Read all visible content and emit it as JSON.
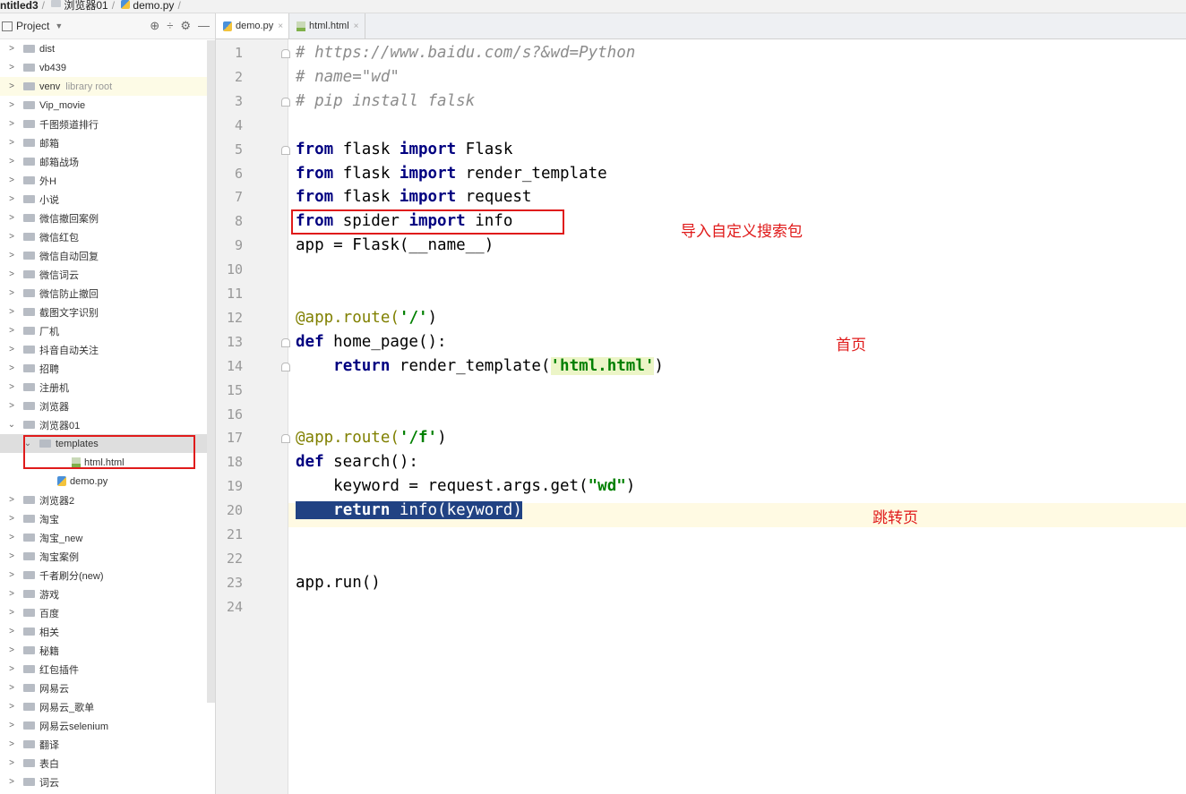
{
  "breadcrumb": [
    "ntitled3",
    "浏览器01",
    "demo.py"
  ],
  "sidebar": {
    "title": "Project",
    "tree": [
      {
        "label": "dist",
        "type": "folder",
        "expanded": false,
        "indent": 0
      },
      {
        "label": "vb439",
        "type": "folder",
        "expanded": false,
        "indent": 0
      },
      {
        "label": "venv",
        "suffix": "library root",
        "type": "folder",
        "expanded": false,
        "indent": 0,
        "highlight": true
      },
      {
        "label": "Vip_movie",
        "type": "folder",
        "expanded": false,
        "indent": 0
      },
      {
        "label": "千图频道排行",
        "type": "folder",
        "expanded": false,
        "indent": 0
      },
      {
        "label": "邮箱",
        "type": "folder",
        "expanded": false,
        "indent": 0
      },
      {
        "label": "邮箱战场",
        "type": "folder",
        "expanded": false,
        "indent": 0
      },
      {
        "label": "外H",
        "type": "folder",
        "expanded": false,
        "indent": 0
      },
      {
        "label": "小说",
        "type": "folder",
        "expanded": false,
        "indent": 0
      },
      {
        "label": "微信撤回案例",
        "type": "folder",
        "expanded": false,
        "indent": 0
      },
      {
        "label": "微信红包",
        "type": "folder",
        "expanded": false,
        "indent": 0
      },
      {
        "label": "微信自动回复",
        "type": "folder",
        "expanded": false,
        "indent": 0
      },
      {
        "label": "微信词云",
        "type": "folder",
        "expanded": false,
        "indent": 0
      },
      {
        "label": "微信防止撤回",
        "type": "folder",
        "expanded": false,
        "indent": 0
      },
      {
        "label": "截图文字识别",
        "type": "folder",
        "expanded": false,
        "indent": 0
      },
      {
        "label": "厂机",
        "type": "folder",
        "expanded": false,
        "indent": 0
      },
      {
        "label": "抖音自动关注",
        "type": "folder",
        "expanded": false,
        "indent": 0
      },
      {
        "label": "招聘",
        "type": "folder",
        "expanded": false,
        "indent": 0
      },
      {
        "label": "注册机",
        "type": "folder",
        "expanded": false,
        "indent": 0
      },
      {
        "label": "浏览器",
        "type": "folder",
        "expanded": false,
        "indent": 0
      },
      {
        "label": "浏览器01",
        "type": "folder",
        "expanded": true,
        "indent": 0
      },
      {
        "label": "templates",
        "type": "folder",
        "expanded": true,
        "indent": 1,
        "selected": true
      },
      {
        "label": "html.html",
        "type": "html",
        "indent": 2
      },
      {
        "label": "demo.py",
        "type": "py",
        "indent": 1
      },
      {
        "label": "浏览器2",
        "type": "folder",
        "expanded": false,
        "indent": 0
      },
      {
        "label": "淘宝",
        "type": "folder",
        "expanded": false,
        "indent": 0
      },
      {
        "label": "淘宝_new",
        "type": "folder",
        "expanded": false,
        "indent": 0
      },
      {
        "label": "淘宝案例",
        "type": "folder",
        "expanded": false,
        "indent": 0
      },
      {
        "label": "千者刷分(new)",
        "type": "folder",
        "expanded": false,
        "indent": 0
      },
      {
        "label": "游戏",
        "type": "folder",
        "expanded": false,
        "indent": 0
      },
      {
        "label": "百度",
        "type": "folder",
        "expanded": false,
        "indent": 0
      },
      {
        "label": "相关",
        "type": "folder",
        "expanded": false,
        "indent": 0
      },
      {
        "label": "秘籍",
        "type": "folder",
        "expanded": false,
        "indent": 0
      },
      {
        "label": "红包插件",
        "type": "folder",
        "expanded": false,
        "indent": 0
      },
      {
        "label": "网易云",
        "type": "folder",
        "expanded": false,
        "indent": 0
      },
      {
        "label": "网易云_歌单",
        "type": "folder",
        "expanded": false,
        "indent": 0
      },
      {
        "label": "网易云selenium",
        "type": "folder",
        "expanded": false,
        "indent": 0
      },
      {
        "label": "翻译",
        "type": "folder",
        "expanded": false,
        "indent": 0
      },
      {
        "label": "表白",
        "type": "folder",
        "expanded": false,
        "indent": 0
      },
      {
        "label": "词云",
        "type": "folder",
        "expanded": false,
        "indent": 0
      }
    ]
  },
  "tabs": [
    {
      "label": "demo.py",
      "type": "py",
      "active": true
    },
    {
      "label": "html.html",
      "type": "html",
      "active": false
    }
  ],
  "editor": {
    "lines": [
      [
        {
          "t": "# https://www.baidu.com/s?&wd=Python",
          "c": "cm"
        }
      ],
      [
        {
          "t": "# name=\"wd\"",
          "c": "cm"
        }
      ],
      [
        {
          "t": "# pip install falsk",
          "c": "cm"
        }
      ],
      [],
      [
        {
          "t": "from",
          "c": "kw"
        },
        {
          "t": " flask "
        },
        {
          "t": "import",
          "c": "kw"
        },
        {
          "t": " Flask"
        }
      ],
      [
        {
          "t": "from",
          "c": "kw"
        },
        {
          "t": " flask "
        },
        {
          "t": "import",
          "c": "kw"
        },
        {
          "t": " render_template"
        }
      ],
      [
        {
          "t": "from",
          "c": "kw"
        },
        {
          "t": " flask "
        },
        {
          "t": "import",
          "c": "kw"
        },
        {
          "t": " request"
        }
      ],
      [
        {
          "t": "from",
          "c": "kw"
        },
        {
          "t": " spider "
        },
        {
          "t": "import",
          "c": "kw"
        },
        {
          "t": " info"
        }
      ],
      [
        {
          "t": "app = Flask(__name__)"
        }
      ],
      [],
      [],
      [
        {
          "t": "@app.route(",
          "c": "dec"
        },
        {
          "t": "'/'",
          "c": "str"
        },
        {
          "t": ")"
        }
      ],
      [
        {
          "t": "def",
          "c": "kw"
        },
        {
          "t": " home_page():"
        }
      ],
      [
        {
          "t": "    "
        },
        {
          "t": "return",
          "c": "kw"
        },
        {
          "t": " render_template("
        },
        {
          "t": "'html.html'",
          "c": "str str-bg"
        },
        {
          "t": ")"
        }
      ],
      [],
      [],
      [
        {
          "t": "@app.route(",
          "c": "dec"
        },
        {
          "t": "'/f'",
          "c": "str"
        },
        {
          "t": ")"
        }
      ],
      [
        {
          "t": "def",
          "c": "kw"
        },
        {
          "t": " search():"
        }
      ],
      [
        {
          "t": "    keyword = request.args.get("
        },
        {
          "t": "\"wd\"",
          "c": "str"
        },
        {
          "t": ")"
        }
      ],
      [
        {
          "t": "    ",
          "c": "sel"
        },
        {
          "t": "return",
          "c": "kw sel"
        },
        {
          "t": " info(keyword)",
          "c": "sel"
        }
      ],
      [],
      [],
      [
        {
          "t": "app.run()"
        }
      ],
      []
    ]
  },
  "annotations": {
    "import_note": "导入自定义搜索包",
    "home_note": "首页",
    "jump_note": "跳转页"
  }
}
